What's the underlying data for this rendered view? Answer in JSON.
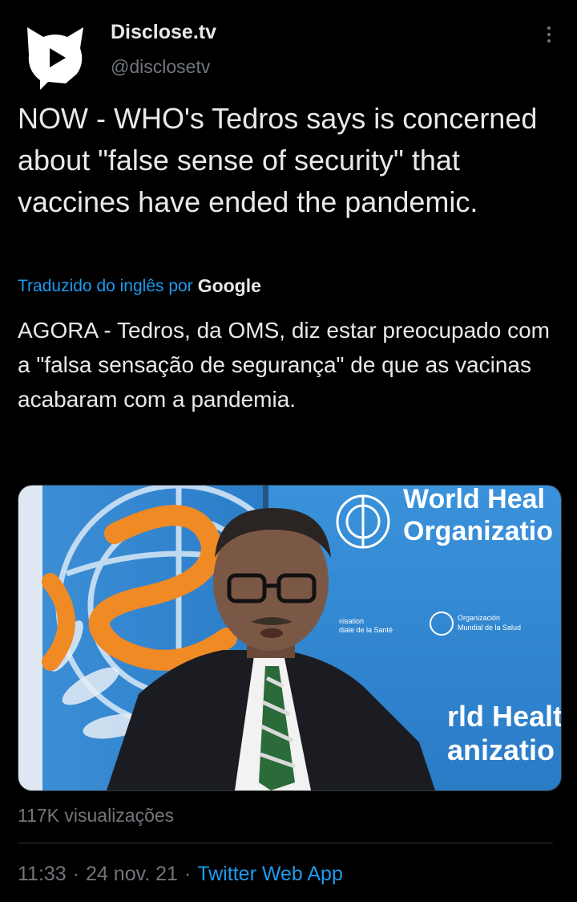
{
  "account": {
    "display_name": "Disclose.tv",
    "handle": "@disclosetv",
    "avatar_icon": "play-cat-logo-icon"
  },
  "tweet": {
    "text": "NOW - WHO's Tedros says is concerned about \"false sense of security\" that vaccines have ended the pandemic.",
    "translated_by": "Traduzido do inglês por",
    "translator": "Google",
    "translation": "AGORA - Tedros, da OMS, diz estar preocupado com a \"falsa sensação de segurança\" de que as vacinas acabaram com a pandemia."
  },
  "media": {
    "banner_line1": "World Heal",
    "banner_line2": "Organizatio",
    "fr_line1": "nisation",
    "fr_line2": "diale de la Santé",
    "es_line1": "Organización",
    "es_line2": "Mundial de la Salud",
    "lower_line1": "rld Healt",
    "lower_line2": "anizatio"
  },
  "stats": {
    "views": "117K visualizações"
  },
  "meta": {
    "time": "11:33",
    "separator": "·",
    "date": "24 nov. 21",
    "app": "Twitter Web App"
  },
  "colors": {
    "background": "#000000",
    "link": "#1d9bf0",
    "muted": "#71767b",
    "who_blue": "#2f8fd8"
  }
}
